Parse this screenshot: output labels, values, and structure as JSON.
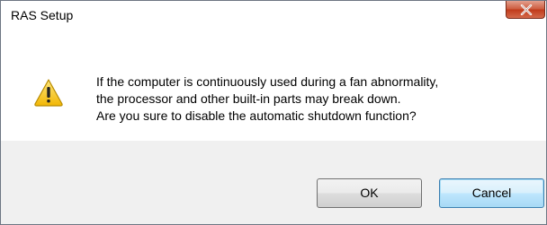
{
  "window": {
    "title": "RAS Setup"
  },
  "dialog": {
    "icon": "warning-icon",
    "message_lines": [
      "If the computer is continuously used during a fan abnormality,",
      "the processor and other built-in parts may break down.",
      "Are you sure to disable the automatic shutdown function?"
    ]
  },
  "buttons": {
    "ok_label": "OK",
    "cancel_label": "Cancel"
  },
  "colors": {
    "close_button": "#c74a2a",
    "footer_bg": "#f0f0f0",
    "default_button_border": "#3c7fb1",
    "warning_yellow": "#f5c518"
  }
}
